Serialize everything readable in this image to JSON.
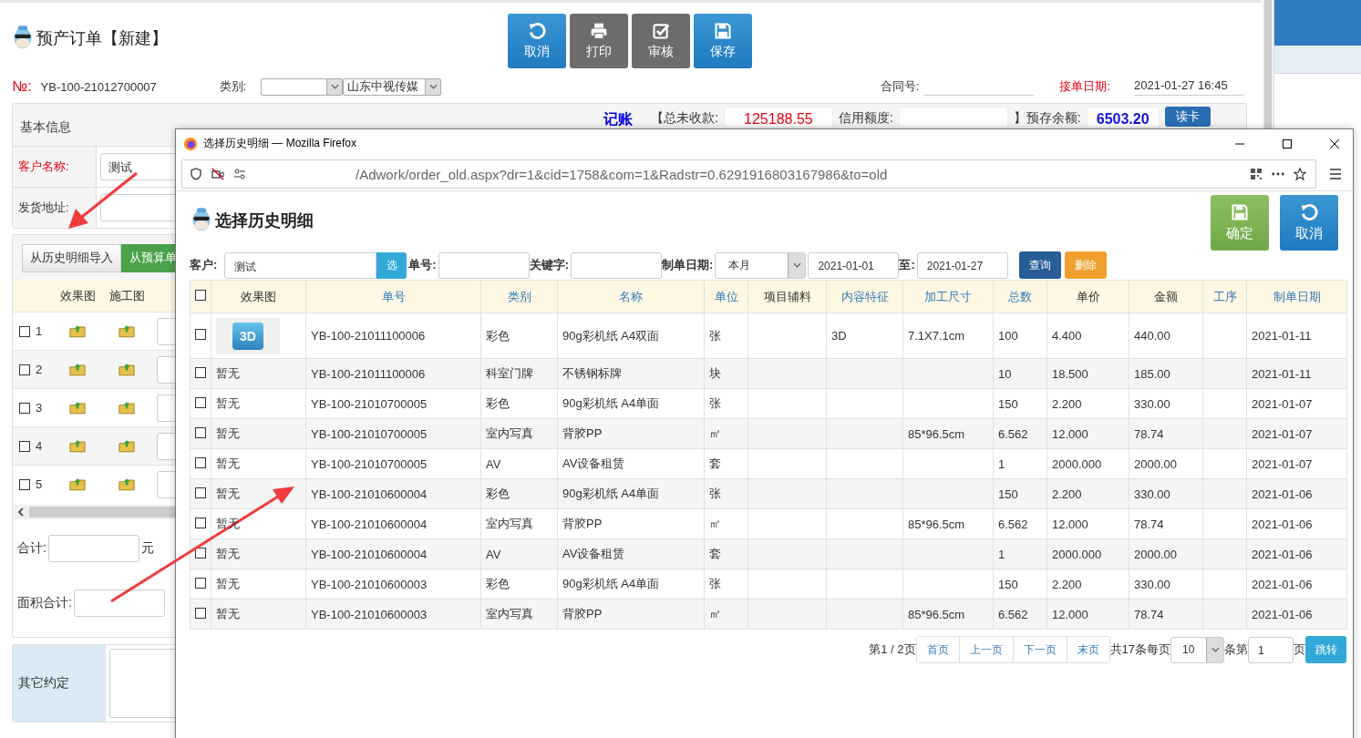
{
  "page": {
    "title": "预产订单【新建】",
    "toolbar": [
      {
        "label": "取消",
        "kind": "undo"
      },
      {
        "label": "打印",
        "kind": "print"
      },
      {
        "label": "审核",
        "kind": "check"
      },
      {
        "label": "保存",
        "kind": "save"
      }
    ],
    "order_no": {
      "label": "№:",
      "value": "YB-100-21012700007"
    },
    "category": {
      "label": "类别:",
      "company": "山东中视传媒"
    },
    "contract": {
      "label": "合同号:"
    },
    "order_date": {
      "label": "接单日期:",
      "value": "2021-01-27 16:45"
    },
    "basic_info": {
      "title": "基本信息",
      "account": "记账",
      "unpaid_label": "【总未收款:",
      "unpaid": "125188.55",
      "credit_label": "信用额度:",
      "deposit_label": "】预存余额:",
      "deposit": "6503.20",
      "card_button": "读卡"
    },
    "customer": {
      "label": "客户名称:",
      "value": "测试"
    },
    "address": {
      "label": "发货地址:"
    },
    "import_buttons": [
      "从历史明细导入",
      "从预算单"
    ],
    "detail_columns": [
      "效果图",
      "施工图"
    ],
    "detail_rows": [
      {
        "no": "1",
        "checked": false
      },
      {
        "no": "2",
        "checked": false
      },
      {
        "no": "3",
        "checked": false
      },
      {
        "no": "4",
        "checked": false
      },
      {
        "no": "5",
        "checked": false
      }
    ],
    "total": {
      "label": "合计:",
      "unit": "元"
    },
    "area_total": {
      "label": "面积合计:"
    },
    "other_terms": {
      "label": "其它约定"
    }
  },
  "dialog": {
    "window_title": "选择历史明细 — Mozilla Firefox",
    "url": "/Adwork/order_old.aspx?dr=1&cid=1758&com=1&Radstr=0.6291916803167986&to=old",
    "heading": "选择历史明细",
    "buttons": [
      {
        "label": "确定",
        "kind": "save"
      },
      {
        "label": "取消",
        "kind": "undo"
      }
    ],
    "filters": {
      "customer_label": "客户:",
      "customer": "测试",
      "pick_button": "选",
      "order_label": "单号:",
      "keyword_label": "关键字:",
      "date_label": "制单日期:",
      "period": "本月",
      "from": "2021-01-01",
      "to_label": "至:",
      "to": "2021-01-27",
      "query_button": "查询",
      "delete_button": "删除"
    },
    "all_checked": false,
    "columns": [
      {
        "label": "效果图",
        "link": false
      },
      {
        "label": "单号",
        "link": true
      },
      {
        "label": "类别",
        "link": true
      },
      {
        "label": "名称",
        "link": true
      },
      {
        "label": "单位",
        "link": true
      },
      {
        "label": "项目辅料",
        "link": false
      },
      {
        "label": "内容特征",
        "link": true
      },
      {
        "label": "加工尺寸",
        "link": true
      },
      {
        "label": "总数",
        "link": true
      },
      {
        "label": "单价",
        "link": false
      },
      {
        "label": "金额",
        "link": false
      },
      {
        "label": "工序",
        "link": true
      },
      {
        "label": "制单日期",
        "link": true
      }
    ],
    "rows": [
      {
        "checked": false,
        "kind": "thumbnail",
        "cells": [
          "3D",
          "YB-100-21011100006",
          "彩色",
          "90g彩机纸 A4双面",
          "张",
          null,
          "3D",
          "7.1X7.1cm",
          "100",
          "4.400",
          "440.00",
          null,
          "2021-01-11"
        ]
      },
      {
        "checked": false,
        "kind": "plain",
        "cells": [
          "暂无",
          "YB-100-21011100006",
          "科室门牌",
          "不锈钢标牌",
          "块",
          null,
          null,
          null,
          "10",
          "18.500",
          "185.00",
          null,
          "2021-01-11"
        ]
      },
      {
        "checked": false,
        "kind": "plain",
        "cells": [
          "暂无",
          "YB-100-21010700005",
          "彩色",
          "90g彩机纸 A4单面",
          "张",
          null,
          null,
          null,
          "150",
          "2.200",
          "330.00",
          null,
          "2021-01-07"
        ]
      },
      {
        "checked": false,
        "kind": "plain",
        "cells": [
          "暂无",
          "YB-100-21010700005",
          "室内写真",
          "背胶PP",
          "㎡",
          null,
          null,
          "85*96.5cm",
          "6.562",
          "12.000",
          "78.74",
          null,
          "2021-01-07"
        ]
      },
      {
        "checked": false,
        "kind": "plain",
        "cells": [
          "暂无",
          "YB-100-21010700005",
          "AV",
          "AV设备租赁",
          "套",
          null,
          null,
          null,
          "1",
          "2000.000",
          "2000.00",
          null,
          "2021-01-07"
        ]
      },
      {
        "checked": false,
        "kind": "plain",
        "cells": [
          "暂无",
          "YB-100-21010600004",
          "彩色",
          "90g彩机纸 A4单面",
          "张",
          null,
          null,
          null,
          "150",
          "2.200",
          "330.00",
          null,
          "2021-01-06"
        ]
      },
      {
        "checked": false,
        "kind": "plain",
        "cells": [
          "暂无",
          "YB-100-21010600004",
          "室内写真",
          "背胶PP",
          "㎡",
          null,
          null,
          "85*96.5cm",
          "6.562",
          "12.000",
          "78.74",
          null,
          "2021-01-06"
        ]
      },
      {
        "checked": false,
        "kind": "plain",
        "cells": [
          "暂无",
          "YB-100-21010600004",
          "AV",
          "AV设备租赁",
          "套",
          null,
          null,
          null,
          "1",
          "2000.000",
          "2000.00",
          null,
          "2021-01-06"
        ]
      },
      {
        "checked": false,
        "kind": "plain",
        "cells": [
          "暂无",
          "YB-100-21010600003",
          "彩色",
          "90g彩机纸 A4单面",
          "张",
          null,
          null,
          null,
          "150",
          "2.200",
          "330.00",
          null,
          "2021-01-06"
        ]
      },
      {
        "checked": false,
        "kind": "plain",
        "cells": [
          "暂无",
          "YB-100-21010600003",
          "室内写真",
          "背胶PP",
          "㎡",
          null,
          null,
          "85*96.5cm",
          "6.562",
          "12.000",
          "78.74",
          null,
          "2021-01-06"
        ]
      }
    ],
    "pager": {
      "page_info": "第1 / 2页",
      "buttons": [
        "首页",
        "上一页",
        "下一页",
        "末页"
      ],
      "total_info": "共17条每页",
      "page_size": "10",
      "goto_label": "条第",
      "goto_page": "1",
      "page_suffix": "页",
      "jump_button": "跳转"
    }
  }
}
